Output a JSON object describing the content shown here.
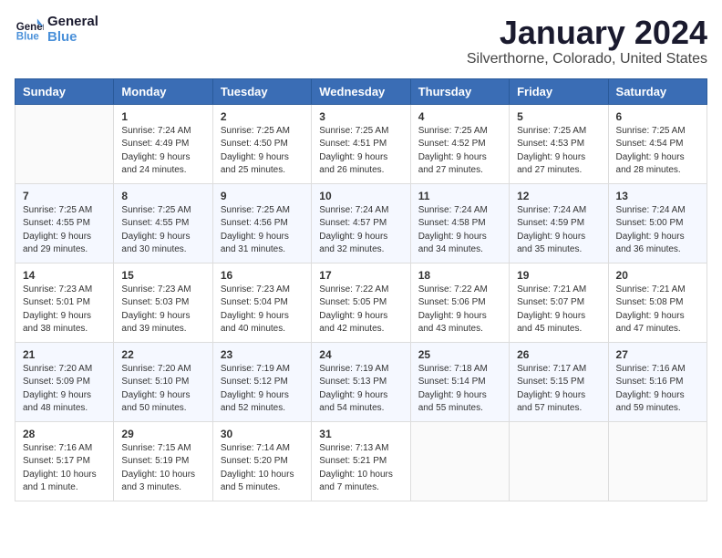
{
  "logo": {
    "text_general": "General",
    "text_blue": "Blue"
  },
  "header": {
    "title": "January 2024",
    "subtitle": "Silverthorne, Colorado, United States"
  },
  "weekdays": [
    "Sunday",
    "Monday",
    "Tuesday",
    "Wednesday",
    "Thursday",
    "Friday",
    "Saturday"
  ],
  "weeks": [
    [
      {
        "day": "",
        "sunrise": "",
        "sunset": "",
        "daylight": ""
      },
      {
        "day": "1",
        "sunrise": "Sunrise: 7:24 AM",
        "sunset": "Sunset: 4:49 PM",
        "daylight": "Daylight: 9 hours and 24 minutes."
      },
      {
        "day": "2",
        "sunrise": "Sunrise: 7:25 AM",
        "sunset": "Sunset: 4:50 PM",
        "daylight": "Daylight: 9 hours and 25 minutes."
      },
      {
        "day": "3",
        "sunrise": "Sunrise: 7:25 AM",
        "sunset": "Sunset: 4:51 PM",
        "daylight": "Daylight: 9 hours and 26 minutes."
      },
      {
        "day": "4",
        "sunrise": "Sunrise: 7:25 AM",
        "sunset": "Sunset: 4:52 PM",
        "daylight": "Daylight: 9 hours and 27 minutes."
      },
      {
        "day": "5",
        "sunrise": "Sunrise: 7:25 AM",
        "sunset": "Sunset: 4:53 PM",
        "daylight": "Daylight: 9 hours and 27 minutes."
      },
      {
        "day": "6",
        "sunrise": "Sunrise: 7:25 AM",
        "sunset": "Sunset: 4:54 PM",
        "daylight": "Daylight: 9 hours and 28 minutes."
      }
    ],
    [
      {
        "day": "7",
        "sunrise": "Sunrise: 7:25 AM",
        "sunset": "Sunset: 4:55 PM",
        "daylight": "Daylight: 9 hours and 29 minutes."
      },
      {
        "day": "8",
        "sunrise": "Sunrise: 7:25 AM",
        "sunset": "Sunset: 4:55 PM",
        "daylight": "Daylight: 9 hours and 30 minutes."
      },
      {
        "day": "9",
        "sunrise": "Sunrise: 7:25 AM",
        "sunset": "Sunset: 4:56 PM",
        "daylight": "Daylight: 9 hours and 31 minutes."
      },
      {
        "day": "10",
        "sunrise": "Sunrise: 7:24 AM",
        "sunset": "Sunset: 4:57 PM",
        "daylight": "Daylight: 9 hours and 32 minutes."
      },
      {
        "day": "11",
        "sunrise": "Sunrise: 7:24 AM",
        "sunset": "Sunset: 4:58 PM",
        "daylight": "Daylight: 9 hours and 34 minutes."
      },
      {
        "day": "12",
        "sunrise": "Sunrise: 7:24 AM",
        "sunset": "Sunset: 4:59 PM",
        "daylight": "Daylight: 9 hours and 35 minutes."
      },
      {
        "day": "13",
        "sunrise": "Sunrise: 7:24 AM",
        "sunset": "Sunset: 5:00 PM",
        "daylight": "Daylight: 9 hours and 36 minutes."
      }
    ],
    [
      {
        "day": "14",
        "sunrise": "Sunrise: 7:23 AM",
        "sunset": "Sunset: 5:01 PM",
        "daylight": "Daylight: 9 hours and 38 minutes."
      },
      {
        "day": "15",
        "sunrise": "Sunrise: 7:23 AM",
        "sunset": "Sunset: 5:03 PM",
        "daylight": "Daylight: 9 hours and 39 minutes."
      },
      {
        "day": "16",
        "sunrise": "Sunrise: 7:23 AM",
        "sunset": "Sunset: 5:04 PM",
        "daylight": "Daylight: 9 hours and 40 minutes."
      },
      {
        "day": "17",
        "sunrise": "Sunrise: 7:22 AM",
        "sunset": "Sunset: 5:05 PM",
        "daylight": "Daylight: 9 hours and 42 minutes."
      },
      {
        "day": "18",
        "sunrise": "Sunrise: 7:22 AM",
        "sunset": "Sunset: 5:06 PM",
        "daylight": "Daylight: 9 hours and 43 minutes."
      },
      {
        "day": "19",
        "sunrise": "Sunrise: 7:21 AM",
        "sunset": "Sunset: 5:07 PM",
        "daylight": "Daylight: 9 hours and 45 minutes."
      },
      {
        "day": "20",
        "sunrise": "Sunrise: 7:21 AM",
        "sunset": "Sunset: 5:08 PM",
        "daylight": "Daylight: 9 hours and 47 minutes."
      }
    ],
    [
      {
        "day": "21",
        "sunrise": "Sunrise: 7:20 AM",
        "sunset": "Sunset: 5:09 PM",
        "daylight": "Daylight: 9 hours and 48 minutes."
      },
      {
        "day": "22",
        "sunrise": "Sunrise: 7:20 AM",
        "sunset": "Sunset: 5:10 PM",
        "daylight": "Daylight: 9 hours and 50 minutes."
      },
      {
        "day": "23",
        "sunrise": "Sunrise: 7:19 AM",
        "sunset": "Sunset: 5:12 PM",
        "daylight": "Daylight: 9 hours and 52 minutes."
      },
      {
        "day": "24",
        "sunrise": "Sunrise: 7:19 AM",
        "sunset": "Sunset: 5:13 PM",
        "daylight": "Daylight: 9 hours and 54 minutes."
      },
      {
        "day": "25",
        "sunrise": "Sunrise: 7:18 AM",
        "sunset": "Sunset: 5:14 PM",
        "daylight": "Daylight: 9 hours and 55 minutes."
      },
      {
        "day": "26",
        "sunrise": "Sunrise: 7:17 AM",
        "sunset": "Sunset: 5:15 PM",
        "daylight": "Daylight: 9 hours and 57 minutes."
      },
      {
        "day": "27",
        "sunrise": "Sunrise: 7:16 AM",
        "sunset": "Sunset: 5:16 PM",
        "daylight": "Daylight: 9 hours and 59 minutes."
      }
    ],
    [
      {
        "day": "28",
        "sunrise": "Sunrise: 7:16 AM",
        "sunset": "Sunset: 5:17 PM",
        "daylight": "Daylight: 10 hours and 1 minute."
      },
      {
        "day": "29",
        "sunrise": "Sunrise: 7:15 AM",
        "sunset": "Sunset: 5:19 PM",
        "daylight": "Daylight: 10 hours and 3 minutes."
      },
      {
        "day": "30",
        "sunrise": "Sunrise: 7:14 AM",
        "sunset": "Sunset: 5:20 PM",
        "daylight": "Daylight: 10 hours and 5 minutes."
      },
      {
        "day": "31",
        "sunrise": "Sunrise: 7:13 AM",
        "sunset": "Sunset: 5:21 PM",
        "daylight": "Daylight: 10 hours and 7 minutes."
      },
      {
        "day": "",
        "sunrise": "",
        "sunset": "",
        "daylight": ""
      },
      {
        "day": "",
        "sunrise": "",
        "sunset": "",
        "daylight": ""
      },
      {
        "day": "",
        "sunrise": "",
        "sunset": "",
        "daylight": ""
      }
    ]
  ]
}
